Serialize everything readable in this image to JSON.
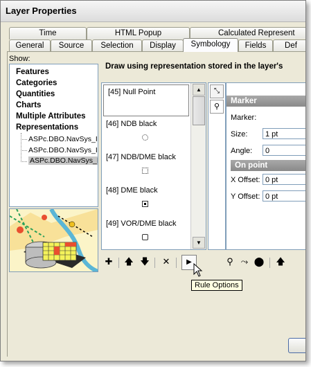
{
  "window": {
    "title": "Layer Properties"
  },
  "tabs_row1": [
    "Time",
    "HTML Popup",
    "Calculated Represent"
  ],
  "tabs_row2": [
    "General",
    "Source",
    "Selection",
    "Display",
    "Symbology",
    "Fields",
    "Def"
  ],
  "show": {
    "label": "Show:",
    "items": [
      "Features",
      "Categories",
      "Quantities",
      "Charts",
      "Multiple Attributes",
      "Representations"
    ],
    "subitems": [
      "ASPc.DBO.NavSys_I",
      "ASPc.DBO.NavSys_I",
      "ASPc.DBO.NavSys_I"
    ]
  },
  "description": "Draw using representation stored in the layer's",
  "rules": [
    {
      "label": "[45] Null Point",
      "icon": "none"
    },
    {
      "label": "[46] NDB black",
      "icon": "dotted-circle"
    },
    {
      "label": "[47] NDB/DME black",
      "icon": "dotted-square"
    },
    {
      "label": "[48] DME black",
      "icon": "dot-square"
    },
    {
      "label": "[49] VOR/DME black",
      "icon": "hexagon"
    }
  ],
  "marker": {
    "header": "Marker",
    "marker_label": "Marker:",
    "size_label": "Size:",
    "size_value": "1 pt",
    "angle_label": "Angle:",
    "angle_value": "0",
    "on_point_header": "On point",
    "x_offset_label": "X Offset:",
    "x_offset_value": "0 pt",
    "y_offset_label": "Y Offset:",
    "y_offset_value": "0 pt"
  },
  "tooltip": "Rule Options",
  "colors": {
    "accent_tab": "#fcfcfe",
    "section_header": "#8a8a8a",
    "selection": "#c6c6c6"
  }
}
